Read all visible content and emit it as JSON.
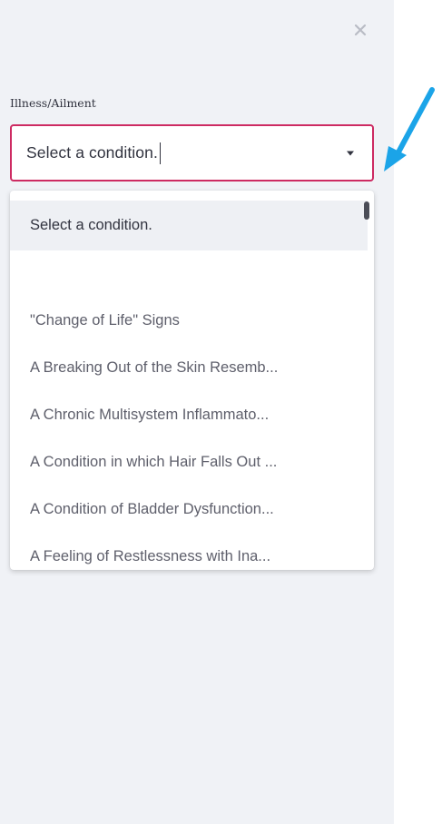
{
  "sidebar": {
    "close_label": "×",
    "field_label": "Illness/Ailment",
    "select": {
      "value": "Select a condition."
    },
    "dropdown": {
      "options": [
        "Select a condition.",
        "",
        "\"Change of Life\" Signs",
        "A Breaking Out of the Skin Resemb...",
        "A Chronic Multisystem Inflammato...",
        "A Condition in which Hair Falls Out ...",
        "A Condition of Bladder Dysfunction...",
        "A Feeling of Restlessness with Ina..."
      ],
      "highlighted_index": 0
    }
  },
  "colors": {
    "sidebar_bg": "#f0f2f6",
    "accent_border": "#cd2b62",
    "annotation_arrow": "#1ba4e8"
  },
  "icons": {
    "close": "close-icon",
    "caret": "chevron-down-icon",
    "annotation": "arrow-pointer-icon"
  }
}
